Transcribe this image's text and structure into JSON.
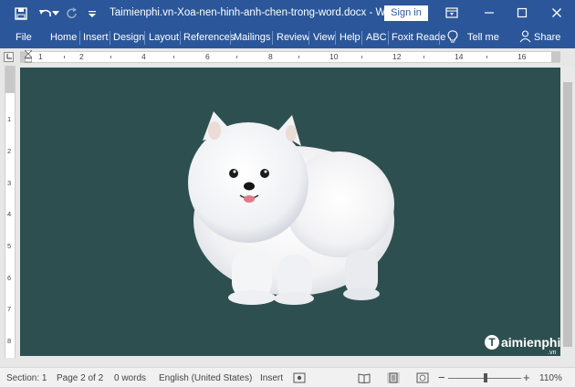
{
  "window": {
    "title": "Taimienphi.vn-Xoa-nen-hinh-anh-chen-trong-word.docx  -  Word",
    "signin_label": "Sign in",
    "quick_access": [
      "save-icon",
      "undo-icon",
      "redo-icon",
      "customize-icon"
    ],
    "controls": [
      "ribbon-display-icon",
      "minimize-icon",
      "maximize-icon",
      "close-icon"
    ]
  },
  "menu": {
    "tabs": [
      "File",
      "Home",
      "Insert",
      "Design",
      "Layout",
      "References",
      "Mailings",
      "Review",
      "View",
      "Help",
      "ABC",
      "Foxit Reade"
    ],
    "tell_me": "Tell me",
    "share": "Share"
  },
  "ruler": {
    "numbers": [
      "1",
      "2",
      "4",
      "6",
      "8",
      "10",
      "12",
      "14",
      "16"
    ],
    "vertical_numbers": [
      "1",
      "2",
      "3",
      "4",
      "5",
      "6",
      "7",
      "8"
    ]
  },
  "document": {
    "background_color": "#2e4f4f",
    "image": "pomeranian-dog-picture",
    "watermark": "aimienphi",
    "watermark_suffix": ".vn"
  },
  "status": {
    "section": "Section: 1",
    "page": "Page 2 of 2",
    "words": "0 words",
    "language": "English (United States)",
    "mode": "Insert",
    "zoom": "110%",
    "zoom_percent": 110
  }
}
